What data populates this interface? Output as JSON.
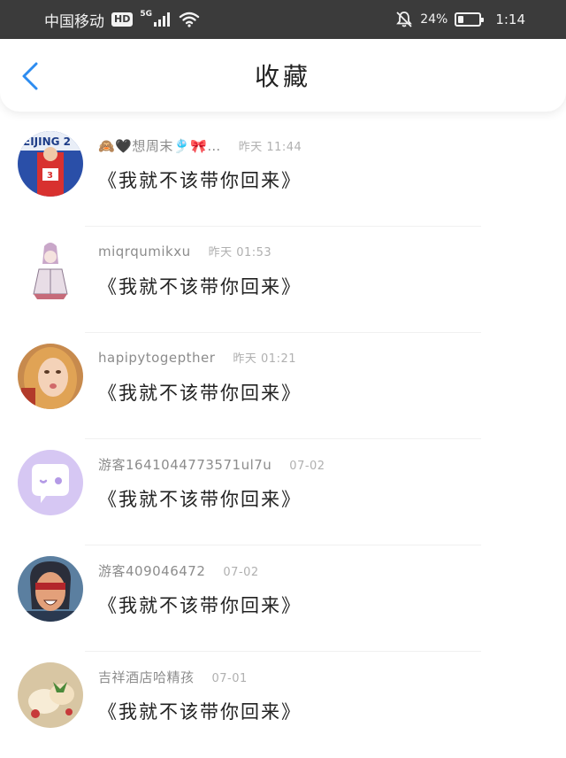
{
  "status_bar": {
    "carrier": "中国移动",
    "hd": "HD",
    "network": "5G",
    "battery_percent": "24%",
    "battery_level": 0.24,
    "time": "1:14"
  },
  "header": {
    "title": "收藏"
  },
  "favorites": [
    {
      "username": "🙈🖤想周末🎐🎀…",
      "time": "昨天 11:44",
      "message": "《我就不该带你回来》"
    },
    {
      "username": "miqrqumikxu",
      "time": "昨天 01:53",
      "message": "《我就不该带你回来》"
    },
    {
      "username": "hapipytogepther",
      "time": "昨天 01:21",
      "message": "《我就不该带你回来》"
    },
    {
      "username": "游客16410447735​71ul7u",
      "time": "07-02",
      "message": "《我就不该带你回来》"
    },
    {
      "username": "游客409046472",
      "time": "07-02",
      "message": "《我就不该带你回来》"
    },
    {
      "username": "吉祥酒店哈精孩",
      "time": "07-01",
      "message": "《我就不该带你回来》"
    }
  ],
  "colors": {
    "status_bar_bg": "#3b3b3b",
    "accent": "#2d8cf0",
    "text_primary": "#222222",
    "text_secondary": "#8c8c8c"
  }
}
